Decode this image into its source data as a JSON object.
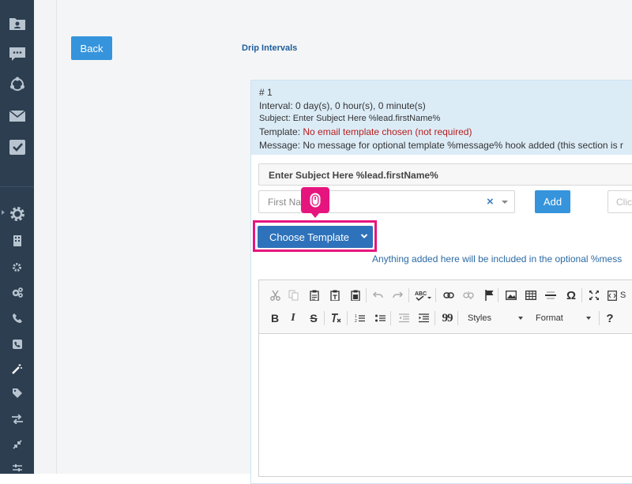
{
  "header": {
    "back_label": "Back",
    "section_title": "Drip Intervals"
  },
  "interval": {
    "number": "# 1",
    "interval_text": "Interval: 0 day(s), 0 hour(s), 0 minute(s)",
    "subject_line": "Subject: Enter Subject Here %lead.firstName%",
    "template_label": "Template: ",
    "template_value": "No email template chosen (not required)",
    "message_line": "Message: No message for optional template %message% hook added (this section is r"
  },
  "form": {
    "subject_value": "Enter Subject Here %lead.firstName%",
    "field_select_placeholder": "First Na",
    "clear_glyph": "×",
    "add_label": "Add",
    "right_placeholder": "Clic",
    "choose_template_label": "Choose Template",
    "hint_text": "Anything added here will be included in the optional %mess"
  },
  "editor": {
    "styles_label": "Styles",
    "format_label": "Format",
    "source_label": "S",
    "bold": "B",
    "italic": "I",
    "strike": "S",
    "help": "?",
    "omega": "Ω",
    "quote": "99"
  },
  "colors": {
    "accent": "#3594dc",
    "sidebar": "#2c3e50",
    "highlight": "#e6157e",
    "primary_dark": "#2d72ba"
  }
}
